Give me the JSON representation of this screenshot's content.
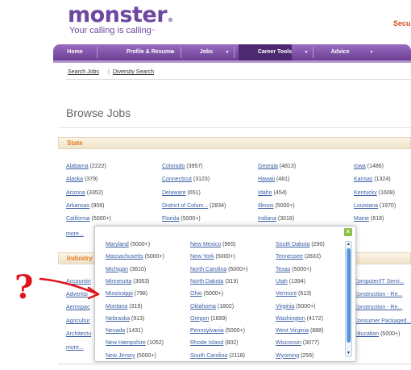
{
  "brand": {
    "name": "monster",
    "tagline": "Your calling is calling",
    "tm": "®",
    "tagline_tm": "™"
  },
  "header_right": "Secu",
  "nav": {
    "items": [
      "Home",
      "Profile & Resume",
      "Jobs",
      "Career Tools",
      "Advice"
    ],
    "active": "Jobs",
    "caret": "▼"
  },
  "sublinks": {
    "search_jobs": "Search Jobs",
    "separator": "|",
    "diversity_search": "Diversity Search"
  },
  "page_title": "Browse Jobs",
  "state_section": {
    "header": "State",
    "columns": [
      [
        {
          "name": "Alabama",
          "count": "(2222)"
        },
        {
          "name": "Alaska",
          "count": "(379)"
        },
        {
          "name": "Arizona",
          "count": "(3352)"
        },
        {
          "name": "Arkansas",
          "count": "(908)"
        },
        {
          "name": "California",
          "count": "(5000+)"
        }
      ],
      [
        {
          "name": "Colorado",
          "count": "(3957)"
        },
        {
          "name": "Connecticut",
          "count": "(3123)"
        },
        {
          "name": "Delaware",
          "count": "(651)"
        },
        {
          "name": "District of Colum...",
          "count": "(2834)"
        },
        {
          "name": "Florida",
          "count": "(5000+)"
        }
      ],
      [
        {
          "name": "Georgia",
          "count": "(4813)"
        },
        {
          "name": "Hawaii",
          "count": "(481)"
        },
        {
          "name": "Idaho",
          "count": "(454)"
        },
        {
          "name": "Illinois",
          "count": "(5000+)"
        },
        {
          "name": "Indiana",
          "count": "(3018)"
        }
      ],
      [
        {
          "name": "Iowa",
          "count": "(1486)"
        },
        {
          "name": "Kansas",
          "count": "(1324)"
        },
        {
          "name": "Kentucky",
          "count": "(1608)"
        },
        {
          "name": "Louisiana",
          "count": "(1970)"
        },
        {
          "name": "Maine",
          "count": "(618)"
        }
      ]
    ],
    "more": "more..."
  },
  "industry_section": {
    "header": "Industry",
    "left_partial": [
      "Accountin",
      "Advertisi",
      "Aerospac",
      "Agricultur",
      "Architectu"
    ],
    "right_partial": [
      {
        "name": "Computer/IT Servi..."
      },
      {
        "name": "Construction - Re..."
      },
      {
        "name": "Construction - Re..."
      },
      {
        "name": "Consumer Packaged..."
      },
      {
        "name": "Education",
        "count": "(5000+)"
      }
    ],
    "more": "more..."
  },
  "popup": {
    "close": "x",
    "columns": [
      [
        {
          "name": "Maryland",
          "count": "(5000+)"
        },
        {
          "name": "Massachusetts",
          "count": "(5000+)"
        },
        {
          "name": "Michigan",
          "count": "(3610)"
        },
        {
          "name": "Minnesota",
          "count": "(3063)"
        },
        {
          "name": "Mississippi",
          "count": "(798)"
        },
        {
          "name": "Montana",
          "count": "(319)"
        },
        {
          "name": "Nebraska",
          "count": "(913)"
        },
        {
          "name": "Nevada",
          "count": "(1431)"
        },
        {
          "name": "New Hampshire",
          "count": "(1052)"
        },
        {
          "name": "New Jersey",
          "count": "(5000+)"
        }
      ],
      [
        {
          "name": "New Mexico",
          "count": "(965)"
        },
        {
          "name": "New York",
          "count": "(5000+)"
        },
        {
          "name": "North Carolina",
          "count": "(5000+)"
        },
        {
          "name": "North Dakota",
          "count": "(319)"
        },
        {
          "name": "Ohio",
          "count": "(5000+)"
        },
        {
          "name": "Oklahoma",
          "count": "(1802)"
        },
        {
          "name": "Oregon",
          "count": "(1699)"
        },
        {
          "name": "Pennsylvania",
          "count": "(5000+)"
        },
        {
          "name": "Rhode Island",
          "count": "(802)"
        },
        {
          "name": "South Carolina",
          "count": "(2118)"
        }
      ],
      [
        {
          "name": "South Dakota",
          "count": "(290)"
        },
        {
          "name": "Tennessee",
          "count": "(2833)"
        },
        {
          "name": "Texas",
          "count": "(5000+)"
        },
        {
          "name": "Utah",
          "count": "(1394)"
        },
        {
          "name": "Vermont",
          "count": "(613)"
        },
        {
          "name": "Virginia",
          "count": "(5000+)"
        },
        {
          "name": "Washington",
          "count": "(4172)"
        },
        {
          "name": "West Virginia",
          "count": "(888)"
        },
        {
          "name": "Wisconsin",
          "count": "(3077)"
        },
        {
          "name": "Wyoming",
          "count": "(256)"
        }
      ]
    ],
    "scroll_up": "▲",
    "scroll_down": "▼"
  },
  "annotation": {
    "mark": "?"
  },
  "colors": {
    "brand_purple": "#6e47a0",
    "link_blue": "#3a5fa5",
    "section_orange": "#e07b1f",
    "annotation_red": "#e0141a"
  }
}
